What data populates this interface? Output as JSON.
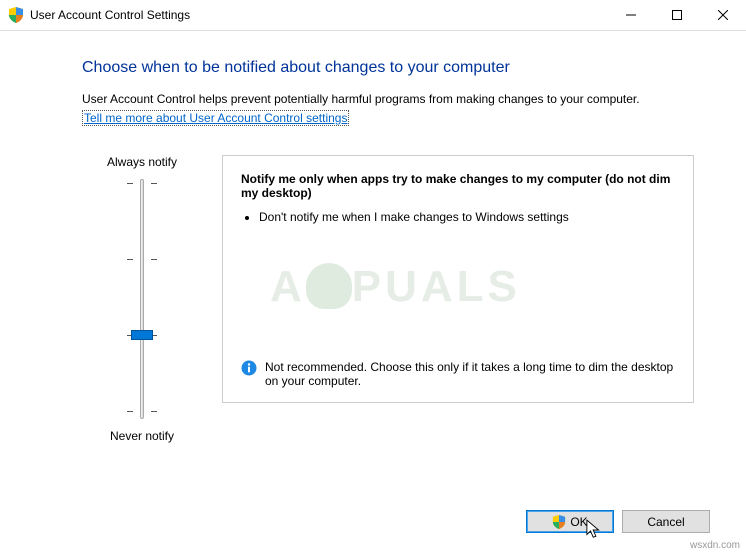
{
  "titlebar": {
    "title": "User Account Control Settings"
  },
  "heading": "Choose when to be notified about changes to your computer",
  "description": "User Account Control helps prevent potentially harmful programs from making changes to your computer.",
  "link": "Tell me more about User Account Control settings",
  "slider": {
    "top_label": "Always notify",
    "bottom_label": "Never notify"
  },
  "panel": {
    "title": "Notify me only when apps try to make changes to my computer (do not dim my desktop)",
    "bullet1": "Don't notify me when I make changes to Windows settings",
    "info": "Not recommended. Choose this only if it takes a long time to dim the desktop on your computer."
  },
  "buttons": {
    "ok": "OK",
    "cancel": "Cancel"
  },
  "watermark": "A   PUALS",
  "siteref": "wsxdn.com"
}
